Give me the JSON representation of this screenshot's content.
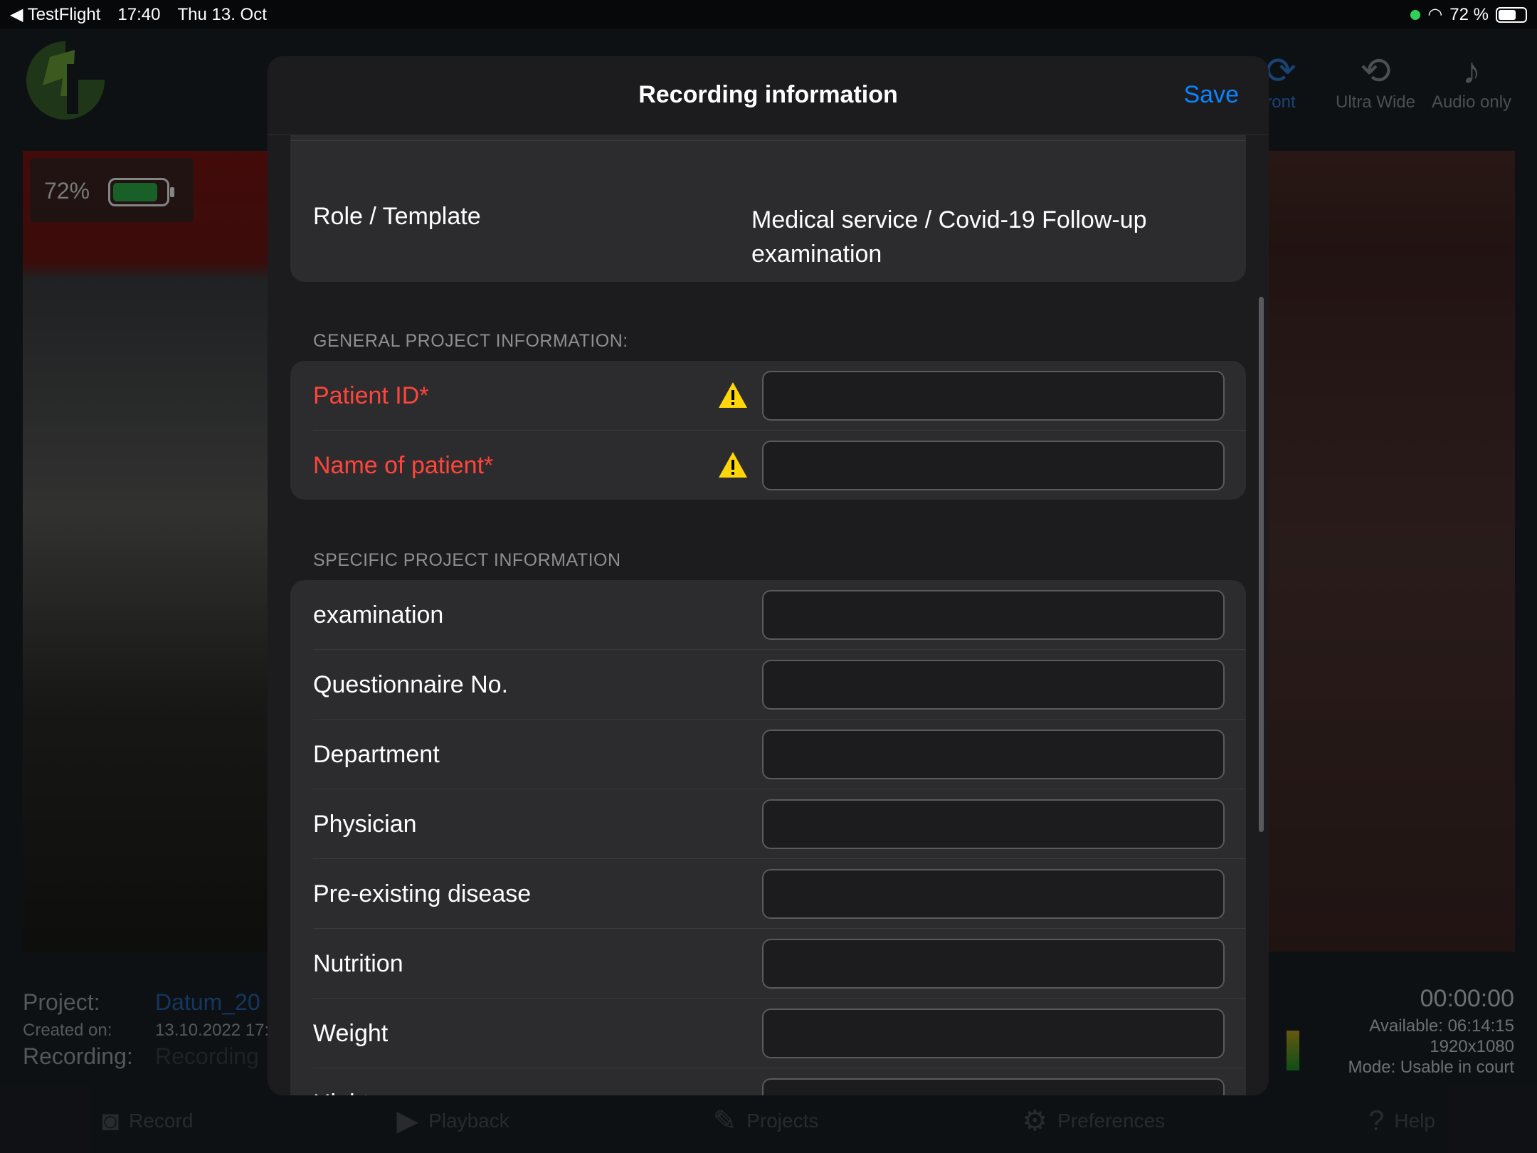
{
  "status_bar": {
    "back_app": "TestFlight",
    "time": "17:40",
    "date": "Thu 13. Oct",
    "battery_percent": "72 %"
  },
  "camera_overlay": {
    "battery_percent": "72%",
    "battery_level": 0.72
  },
  "camera_modes": [
    {
      "label": "ront"
    },
    {
      "label": "Ultra Wide"
    },
    {
      "label": "Audio only"
    }
  ],
  "project_info": {
    "project_label": "Project:",
    "project_value": "Datum_20",
    "created_label": "Created on:",
    "created_value": "13.10.2022 17:",
    "recording_label": "Recording:",
    "recording_value": "Recording"
  },
  "recording_stats": {
    "timer": "00:00:00",
    "available": "Available: 06:14:15",
    "resolution": "1920x1080",
    "mode": "Mode: Usable in court"
  },
  "tab_bar": [
    {
      "label": "Record",
      "icon": "camera-icon"
    },
    {
      "label": "Playback",
      "icon": "play-icon"
    },
    {
      "label": "Projects",
      "icon": "pencil-icon"
    },
    {
      "label": "Preferences",
      "icon": "gear-icon"
    },
    {
      "label": "Help",
      "icon": "question-icon"
    }
  ],
  "modal": {
    "title": "Recording information",
    "save_label": "Save",
    "role_template": {
      "label": "Role / Template",
      "value_line1": "Medical service / Covid-19 Follow-up",
      "value_line2": "examination"
    },
    "general_section": {
      "title": "GENERAL PROJECT INFORMATION:",
      "fields": [
        {
          "label": "Patient ID*",
          "value": "",
          "required": true
        },
        {
          "label": "Name of patient*",
          "value": "",
          "required": true
        }
      ]
    },
    "specific_section": {
      "title": "SPECIFIC PROJECT INFORMATION",
      "fields": [
        {
          "label": "examination",
          "value": ""
        },
        {
          "label": "Questionnaire No.",
          "value": ""
        },
        {
          "label": "Department",
          "value": ""
        },
        {
          "label": "Physician",
          "value": ""
        },
        {
          "label": "Pre-existing disease",
          "value": ""
        },
        {
          "label": "Nutrition",
          "value": ""
        },
        {
          "label": "Weight",
          "value": ""
        },
        {
          "label": "Hight",
          "value": ""
        }
      ]
    }
  },
  "colors": {
    "accent": "#0a84ff",
    "required": "#ff453a",
    "warning": "#ffd60a",
    "modal_bg": "#1c1c1e",
    "group_bg": "#2c2c2e"
  }
}
